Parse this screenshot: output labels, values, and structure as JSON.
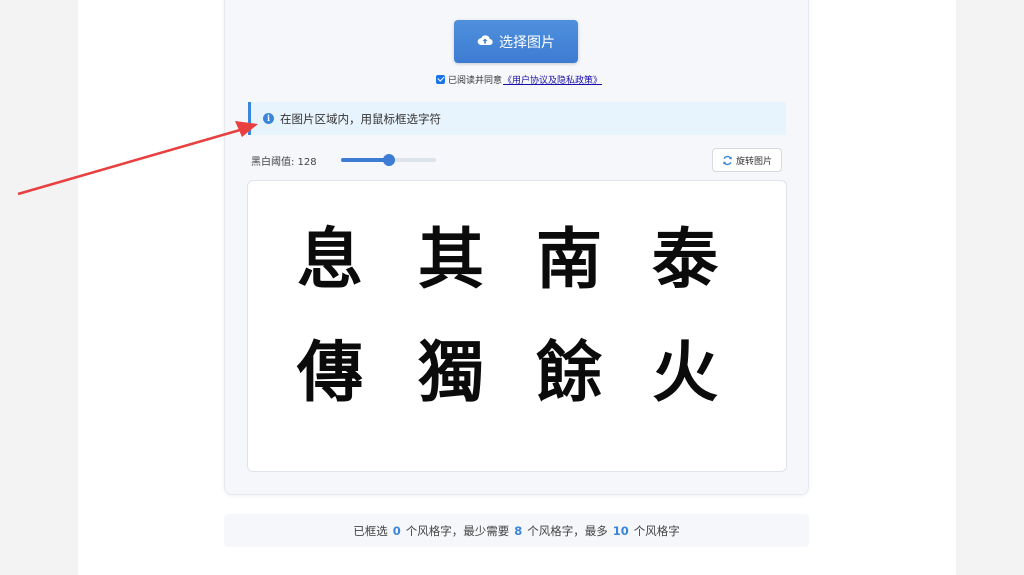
{
  "upload": {
    "label": "选择图片"
  },
  "agreement": {
    "prefix": "已阅读并同意",
    "link": "《用户协议及隐私政策》",
    "checked": true
  },
  "info": {
    "text": "在图片区域内，用鼠标框选字符"
  },
  "threshold": {
    "label": "黑白阈值: 128",
    "value": 128,
    "max": 255
  },
  "rotate": {
    "label": "旋转图片"
  },
  "characters": [
    "息",
    "其",
    "南",
    "泰",
    "傳",
    "獨",
    "餘",
    "火"
  ],
  "status": {
    "p1": "已框选",
    "selected": "0",
    "p2": "个风格字，最少需要",
    "min": "8",
    "p3": "个风格字，最多",
    "max": "10",
    "p4": "个风格字"
  },
  "colors": {
    "accent": "#3d7cd2",
    "arrow": "#e84040",
    "info_bg": "#e8f4fd"
  }
}
